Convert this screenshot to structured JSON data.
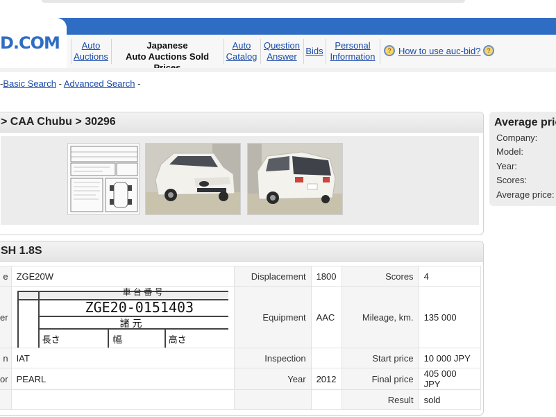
{
  "site": {
    "logo_text": "D.COM"
  },
  "nav": {
    "items": [
      {
        "line1": "Auto",
        "line2": "Auctions"
      },
      {
        "line1": "Japanese",
        "line2": "Auto Auctions Sold Prices"
      },
      {
        "line1": "Auto",
        "line2": "Catalog"
      },
      {
        "line1": "Question",
        "line2": "Answer"
      },
      {
        "line1": "Bids",
        "line2": ""
      },
      {
        "line1": "Personal",
        "line2": "Information"
      }
    ],
    "help_link": "How to use auc-bid?"
  },
  "search": {
    "basic": "Basic Search",
    "advanced": "Advanced Search",
    "sep": "-"
  },
  "lot": {
    "breadcrumb": "> CAA Chubu > 30296",
    "photos": [
      {
        "name": "auction-sheet-thumb"
      },
      {
        "name": "car-front-thumb"
      },
      {
        "name": "car-rear-thumb"
      }
    ],
    "auction_sheet": {
      "chassis_header": "車 台 番 号",
      "chassis_number": "ZGE20-0151403",
      "dims_header": "諸 元",
      "dims_labels": [
        "長さ",
        "幅",
        "高さ"
      ]
    }
  },
  "details": {
    "title": "SH 1.8S",
    "rows": [
      {
        "l1": "e",
        "v1": "ZGE20W",
        "l2": "Displacement",
        "v2": "1800",
        "l3": "Scores",
        "v3": "4"
      },
      {
        "l1": "er",
        "v1": "",
        "l2": "Equipment",
        "v2": "AAC",
        "l3": "Mileage, km.",
        "v3": "135 000"
      },
      {
        "l1": "n",
        "v1": "IAT",
        "l2": "Inspection",
        "v2": "",
        "l3": "Start price",
        "v3": "10 000 JPY"
      },
      {
        "l1": "or",
        "v1": "PEARL",
        "l2": "Year",
        "v2": "2012",
        "l3": "Final price",
        "v3": "405 000 JPY"
      },
      {
        "l1": "",
        "v1": "",
        "l2": "",
        "v2": "",
        "l3": "Result",
        "v3": "sold"
      }
    ]
  },
  "sidebar": {
    "title": "Average price",
    "rows": [
      "Company:",
      "Model:",
      "Year:",
      "Scores:",
      "Average price:"
    ]
  },
  "colors": {
    "brand_blue": "#2f6dc4",
    "link": "#1a4aa8"
  }
}
